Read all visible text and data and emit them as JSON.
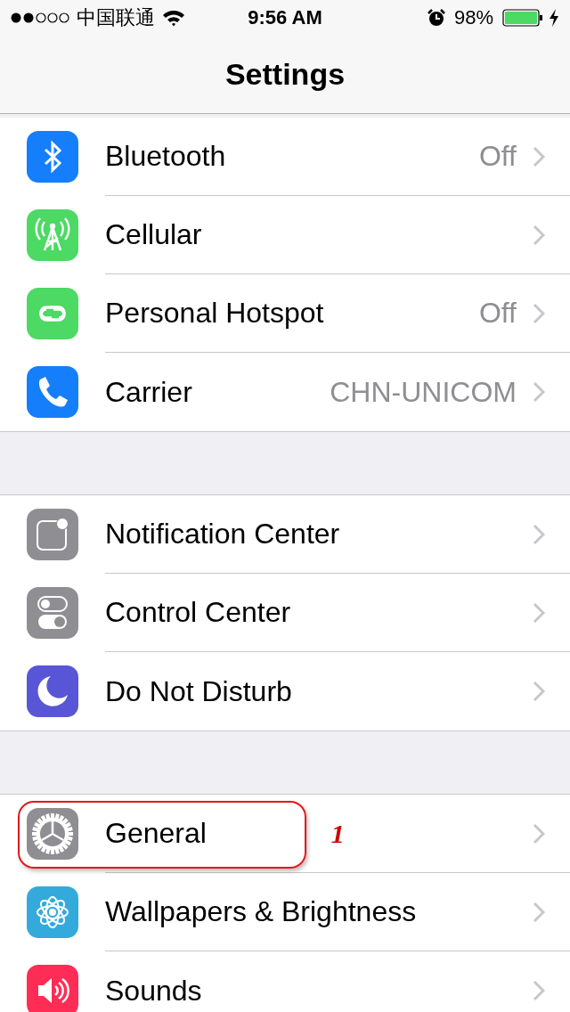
{
  "status_bar": {
    "carrier": "中国联通",
    "time": "9:56 AM",
    "battery": "98%"
  },
  "nav": {
    "title": "Settings"
  },
  "groups": [
    {
      "items": [
        {
          "kind": "bluetooth",
          "label": "Bluetooth",
          "value": "Off"
        },
        {
          "kind": "cellular",
          "label": "Cellular"
        },
        {
          "kind": "hotspot",
          "label": "Personal Hotspot",
          "value": "Off"
        },
        {
          "kind": "carrier",
          "label": "Carrier",
          "value": "CHN-UNICOM"
        }
      ]
    },
    {
      "items": [
        {
          "kind": "notifications",
          "label": "Notification Center"
        },
        {
          "kind": "control",
          "label": "Control Center"
        },
        {
          "kind": "dnd",
          "label": "Do Not Disturb"
        }
      ]
    },
    {
      "items": [
        {
          "kind": "general",
          "label": "General",
          "annotated": true,
          "annotation_label": "1"
        },
        {
          "kind": "wallpaper",
          "label": "Wallpapers & Brightness"
        },
        {
          "kind": "sounds",
          "label": "Sounds"
        }
      ]
    }
  ]
}
